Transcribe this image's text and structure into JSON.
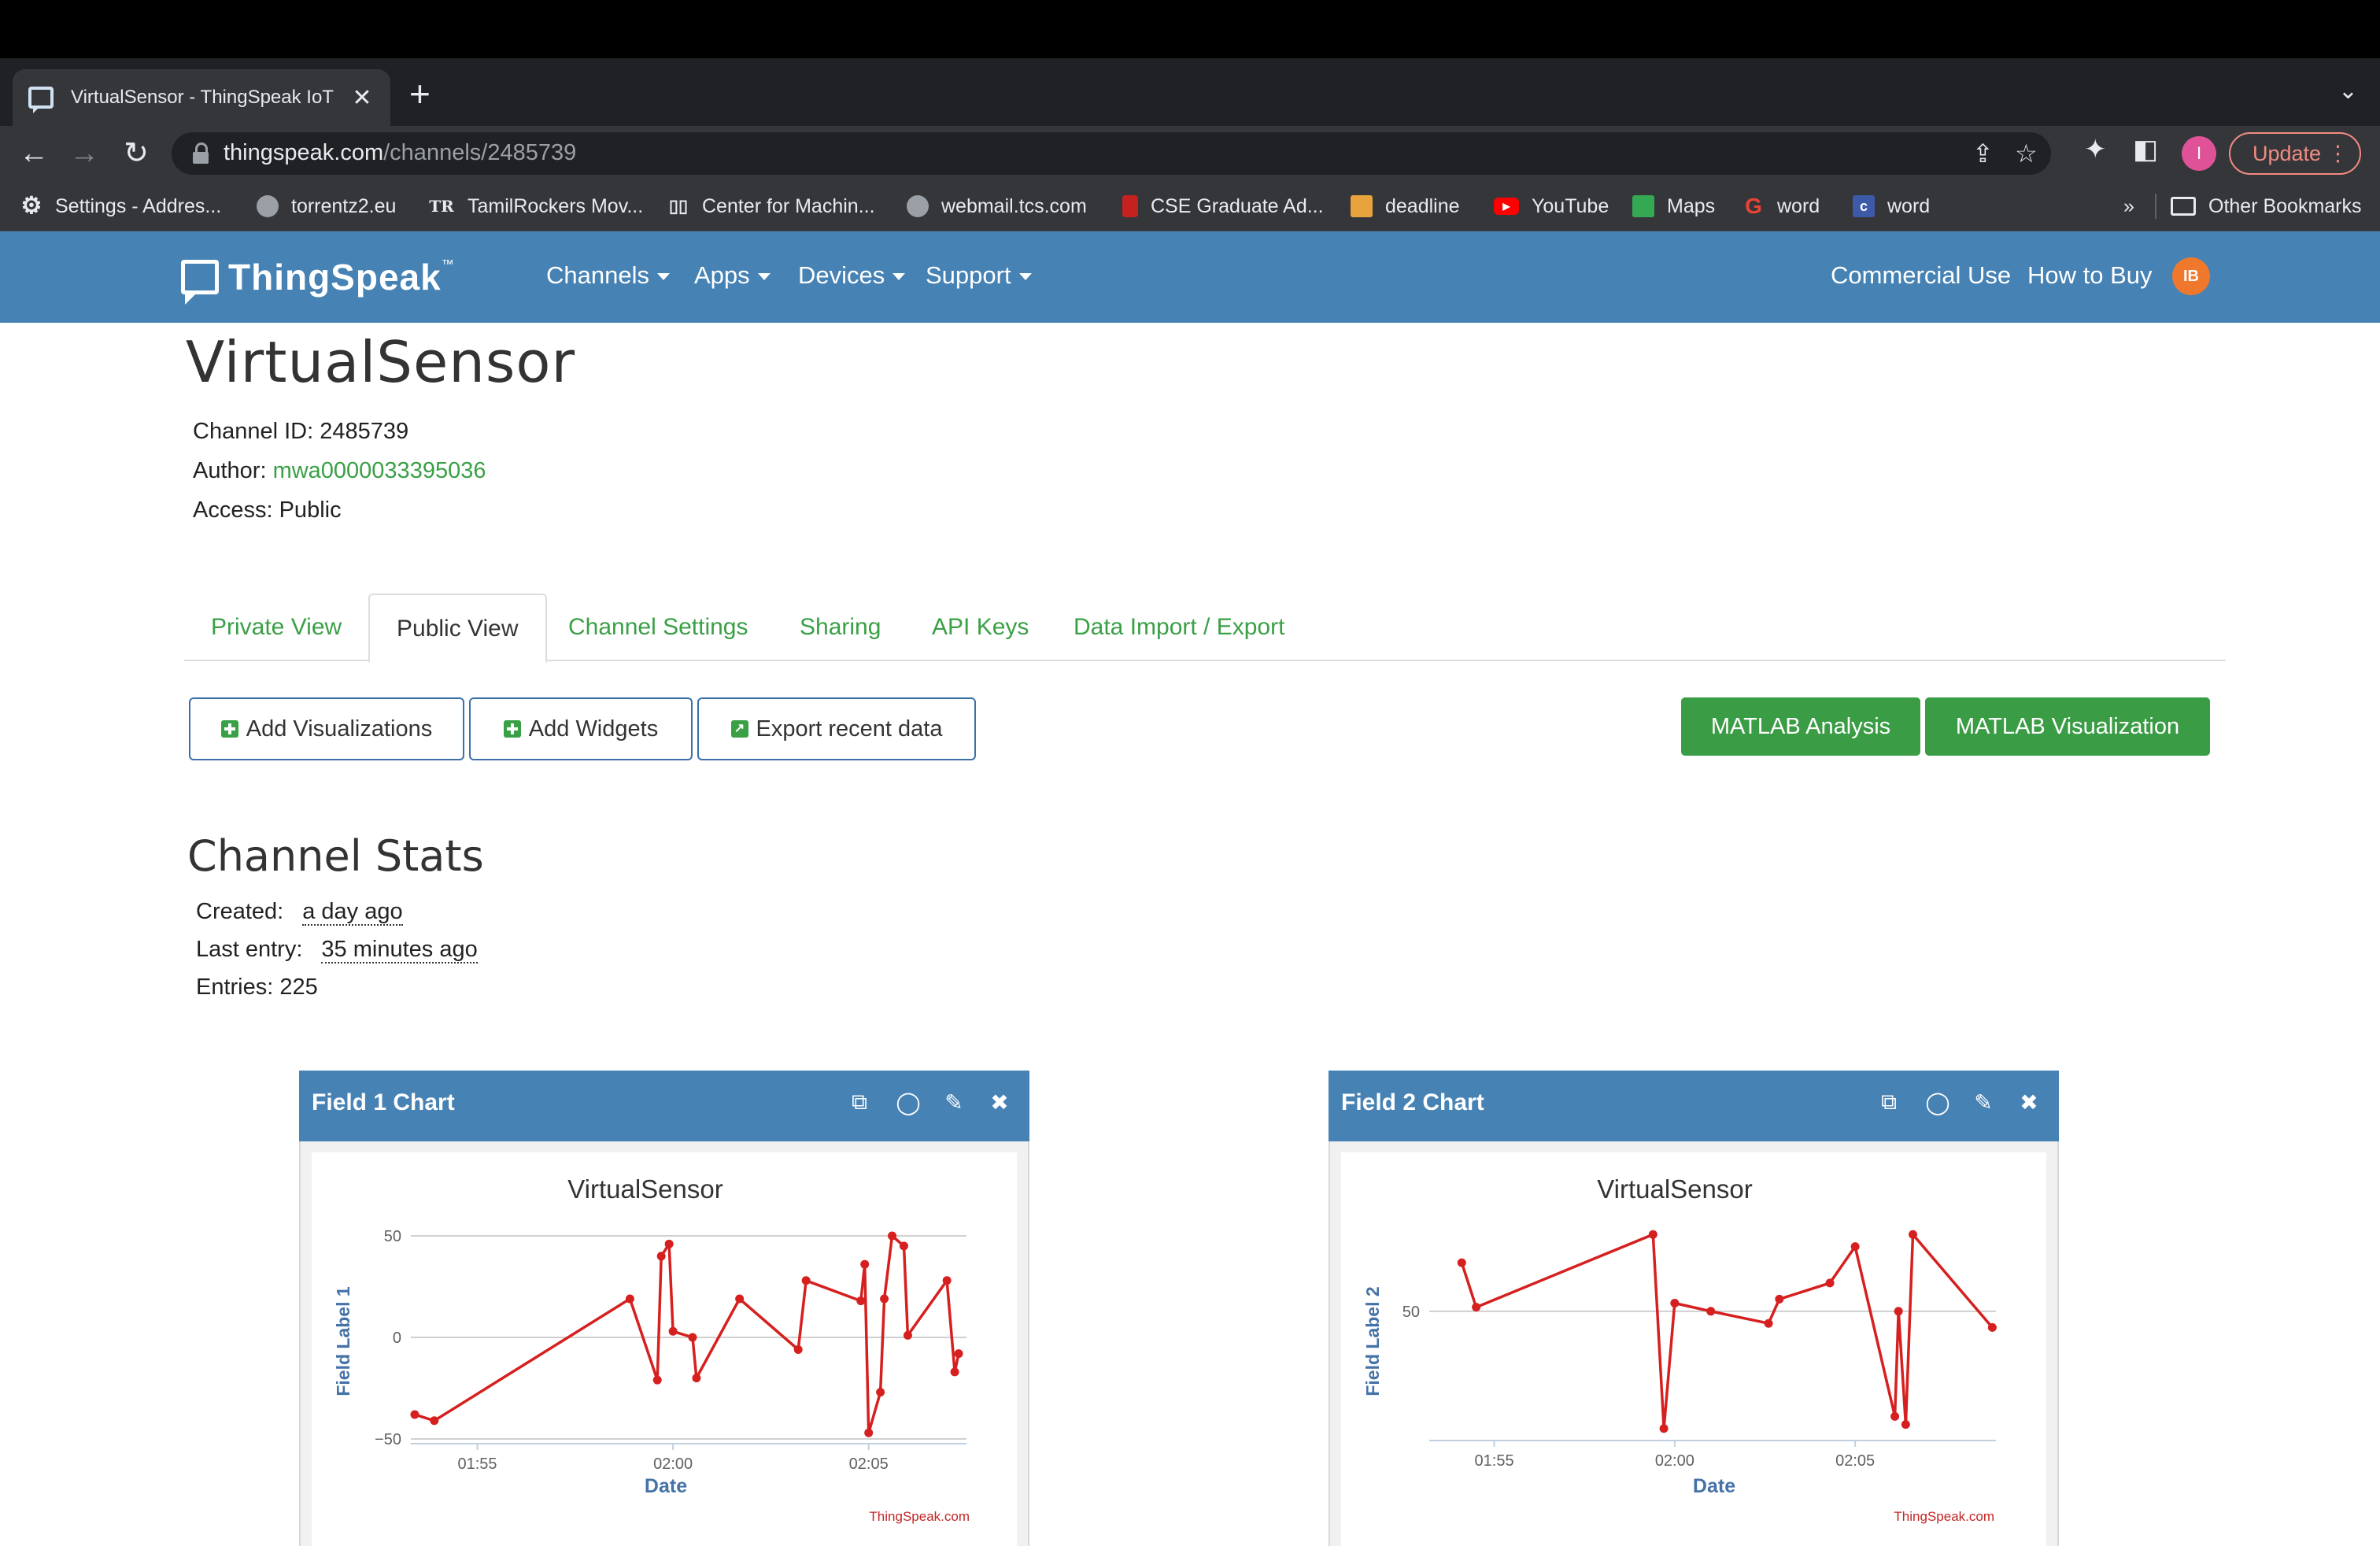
{
  "browser": {
    "tab_title": "VirtualSensor - ThingSpeak IoT",
    "url_host": "thingspeak.com",
    "url_path": "/channels/2485739",
    "profile_initial": "I",
    "update_label": "Update",
    "bookmarks": [
      {
        "label": "Settings - Addres...",
        "icon": "gear-icon"
      },
      {
        "label": "torrentz2.eu",
        "icon": "globe-icon"
      },
      {
        "label": "TamilRockers Mov...",
        "icon": "tr-logo-icon"
      },
      {
        "label": "Center for Machin...",
        "icon": "cmi-logo-icon"
      },
      {
        "label": "webmail.tcs.com",
        "icon": "globe-icon"
      },
      {
        "label": "CSE Graduate Ad...",
        "icon": "shield-icon"
      },
      {
        "label": "deadline",
        "icon": "calendar-icon"
      },
      {
        "label": "YouTube",
        "icon": "youtube-icon"
      },
      {
        "label": "Maps",
        "icon": "maps-icon"
      },
      {
        "label": "word",
        "icon": "grammar-icon"
      },
      {
        "label": "word",
        "icon": "c-logo-icon"
      }
    ],
    "overflow_label": "»",
    "other_bookmarks": "Other Bookmarks"
  },
  "nav": {
    "logo": "ThingSpeak",
    "logo_tm": "™",
    "menus": [
      "Channels",
      "Apps",
      "Devices",
      "Support"
    ],
    "commercial_use": "Commercial Use",
    "how_to_buy": "How to Buy",
    "avatar": "IB"
  },
  "channel": {
    "title": "VirtualSensor",
    "id_label": "Channel ID:",
    "id": "2485739",
    "author_label": "Author:",
    "author": "mwa0000033395036",
    "access_label": "Access:",
    "access": "Public"
  },
  "tabs": [
    "Private View",
    "Public View",
    "Channel Settings",
    "Sharing",
    "API Keys",
    "Data Import / Export"
  ],
  "active_tab": "Public View",
  "actions": {
    "add_visualizations": "Add Visualizations",
    "add_widgets": "Add Widgets",
    "export_recent": "Export recent data",
    "matlab_analysis": "MATLAB Analysis",
    "matlab_visualization": "MATLAB Visualization"
  },
  "stats": {
    "title": "Channel Stats",
    "created_label": "Created:",
    "created": "a day ago",
    "last_entry_label": "Last entry:",
    "last_entry": "35 minutes ago",
    "entries_label": "Entries:",
    "entries": "225"
  },
  "colors": {
    "navbar": "#4682b4",
    "link_green": "#3aa046",
    "button_green": "#3a9c44",
    "series_red": "#d62020"
  },
  "widgets": [
    {
      "title": "Field 1 Chart"
    },
    {
      "title": "Field 2 Chart"
    }
  ],
  "chart_data": [
    {
      "type": "line",
      "title": "VirtualSensor",
      "xlabel": "Date",
      "ylabel": "Field Label 1",
      "credit": "ThingSpeak.com",
      "x_ticks": [
        "01:55",
        "02:00",
        "02:05"
      ],
      "x_tick_minutes": [
        115,
        120,
        125
      ],
      "xlim": [
        113.3,
        127.5
      ],
      "y_ticks": [
        "50",
        "0",
        "−50"
      ],
      "y_tick_values": [
        50,
        0,
        -50
      ],
      "ylim": [
        -50,
        50
      ],
      "series": [
        {
          "x": [
            113.4,
            113.9,
            118.9,
            119.6,
            119.7,
            119.9,
            120.0,
            120.5,
            120.6,
            121.7,
            123.2,
            123.4,
            124.8,
            124.9,
            125.0,
            125.3,
            125.4,
            125.6,
            125.9,
            126.0,
            127.0,
            127.2,
            127.3
          ],
          "y": [
            -38,
            -41,
            19,
            -21,
            40,
            46,
            3,
            0,
            -20,
            19,
            -6,
            28,
            18,
            36,
            -47,
            -27,
            19,
            50,
            45,
            1,
            28,
            -17,
            -8
          ]
        }
      ]
    },
    {
      "type": "line",
      "title": "VirtualSensor",
      "xlabel": "Date",
      "ylabel": "Field Label 2",
      "credit": "ThingSpeak.com",
      "x_ticks": [
        "01:55",
        "02:00",
        "02:05"
      ],
      "x_tick_minutes": [
        115,
        120,
        125
      ],
      "xlim": [
        113.2,
        128.9
      ],
      "y_ticks": [
        "50"
      ],
      "y_tick_values": [
        50
      ],
      "ylim": [
        34.6,
        60.3
      ],
      "series": [
        {
          "x": [
            114.1,
            114.5,
            119.4,
            119.7,
            120.0,
            121.0,
            122.6,
            122.9,
            124.3,
            125.0,
            126.1,
            126.2,
            126.4,
            126.6,
            128.8
          ],
          "y": [
            56,
            50.5,
            59.5,
            35.5,
            51,
            50,
            48.5,
            51.5,
            53.5,
            58,
            37,
            50,
            36,
            59.5,
            48
          ]
        }
      ]
    }
  ]
}
